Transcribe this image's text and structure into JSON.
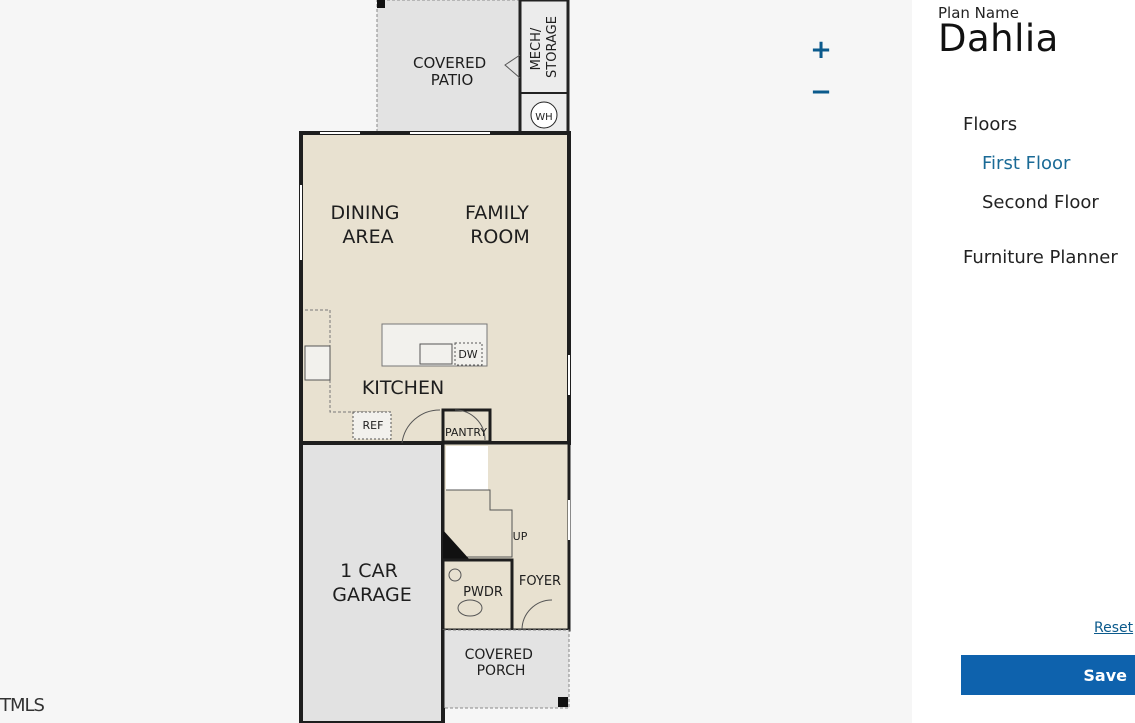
{
  "controls": {
    "zoom_in": "+",
    "zoom_out": "−"
  },
  "panel": {
    "plan_label": "Plan Name",
    "plan_name": "Dahlia",
    "floors_heading": "Floors",
    "floors": [
      "First Floor",
      "Second Floor"
    ],
    "selected_floor": "First Floor",
    "furniture_planner": "Furniture Planner",
    "reset": "Reset",
    "save": "Save"
  },
  "rooms": {
    "covered_patio": [
      "COVERED",
      "PATIO"
    ],
    "mech_storage": [
      "MECH/",
      "STORAGE"
    ],
    "wh": "WH",
    "dining": [
      "DINING",
      "AREA"
    ],
    "family": [
      "FAMILY",
      "ROOM"
    ],
    "dw": "DW",
    "kitchen": "KITCHEN",
    "ref": "REF",
    "pantry": "PANTRY",
    "up": "UP",
    "garage": [
      "1 CAR",
      "GARAGE"
    ],
    "pwdr": "PWDR",
    "foyer": "FOYER",
    "covered_porch": [
      "COVERED",
      "PORCH"
    ]
  },
  "watermark": "TMLS",
  "colors": {
    "room_fill": "#e8e1d0",
    "garage_fill": "#e2e2e2",
    "patio_fill": "#e2e2e2",
    "accent": "#0e62ad",
    "link": "#1a6a96"
  }
}
